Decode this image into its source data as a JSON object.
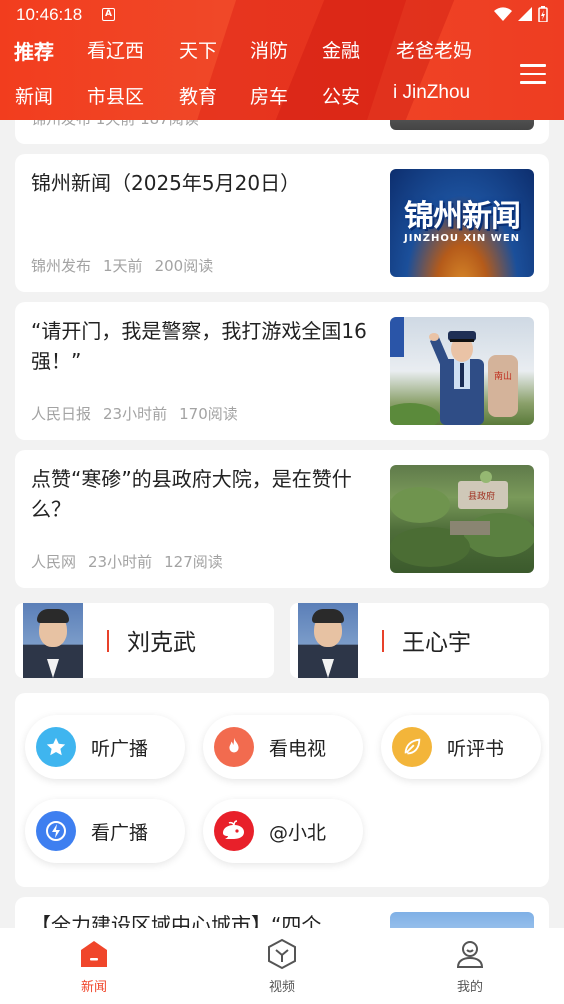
{
  "status_bar": {
    "time": "10:46:18",
    "notification": "A"
  },
  "nav": {
    "row1": [
      "推荐",
      "看辽西",
      "天下",
      "消防",
      "金融",
      "老爸老妈"
    ],
    "row2": [
      "新闻",
      "市县区",
      "教育",
      "房车",
      "公安",
      "i JinZhou"
    ],
    "active": "推荐"
  },
  "partial_top_meta": "锦州发布  1天前  187阅读",
  "articles": [
    {
      "title": "锦州新闻（2025年5月20日）",
      "source": "锦州发布",
      "time": "1天前",
      "reads": "200阅读",
      "thumb_text": "锦州新闻",
      "thumb_sub": "JINZHOU XIN WEN"
    },
    {
      "title": "“请开门，我是警察，我打游戏全国16强！”",
      "source": "人民日报",
      "time": "23小时前",
      "reads": "170阅读"
    },
    {
      "title": "点赞“寒碜”的县政府大院，是在赞什么？",
      "source": "人民网",
      "time": "23小时前",
      "reads": "127阅读"
    }
  ],
  "people": [
    {
      "name": "刘克武"
    },
    {
      "name": "王心宇"
    }
  ],
  "quick_links": [
    {
      "label": "听广播",
      "icon": "star-icon",
      "color": "#3fb5ef"
    },
    {
      "label": "看电视",
      "icon": "flame-icon",
      "color": "#f26b4f"
    },
    {
      "label": "听评书",
      "icon": "leaf-icon",
      "color": "#f3b53a"
    },
    {
      "label": "看广播",
      "icon": "lightning-icon",
      "color": "#3e7ff0"
    },
    {
      "label": "@小北",
      "icon": "whale-icon",
      "color": "#e8202a"
    }
  ],
  "partial_bottom_title": "【全力建设区域中心城市】“四个",
  "tabs": [
    {
      "label": "新闻",
      "icon": "home-icon",
      "active": true
    },
    {
      "label": "视频",
      "icon": "video-cube-icon",
      "active": false
    },
    {
      "label": "我的",
      "icon": "profile-icon",
      "active": false
    }
  ],
  "accent_color": "#f0462b"
}
